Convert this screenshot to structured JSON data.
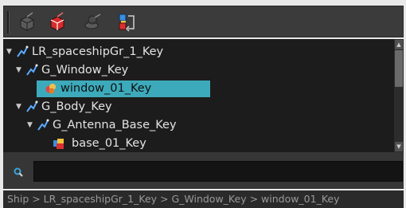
{
  "toolbar": {
    "buttons": [
      {
        "name": "peg-icon"
      },
      {
        "name": "add-drawing-icon"
      },
      {
        "name": "add-camera-icon"
      },
      {
        "name": "reparent-icon"
      }
    ]
  },
  "tree": {
    "nodes": [
      {
        "label": "LR_spaceshipGr_1_Key",
        "expanded": true,
        "icon": "peg-icon"
      },
      {
        "label": "G_Window_Key",
        "expanded": true,
        "icon": "peg-icon"
      },
      {
        "label": "window_01_Key",
        "selected": true,
        "icon": "drawing-layer-icon"
      },
      {
        "label": "G_Body_Key",
        "expanded": true,
        "icon": "peg-icon"
      },
      {
        "label": "G_Antenna_Base_Key",
        "expanded": true,
        "icon": "peg-icon"
      },
      {
        "label": "base_01_Key",
        "icon": "drawing-layer-icon"
      }
    ]
  },
  "search": {
    "value": "",
    "placeholder": ""
  },
  "breadcrumb": {
    "text": "Ship > LR_spaceshipGr_1_Key > G_Window_Key > window_01_Key"
  },
  "colors": {
    "selection": "#3daabb",
    "tree_bg": "#1c1c1c",
    "toolbar_bg": "#3b3b3b"
  }
}
